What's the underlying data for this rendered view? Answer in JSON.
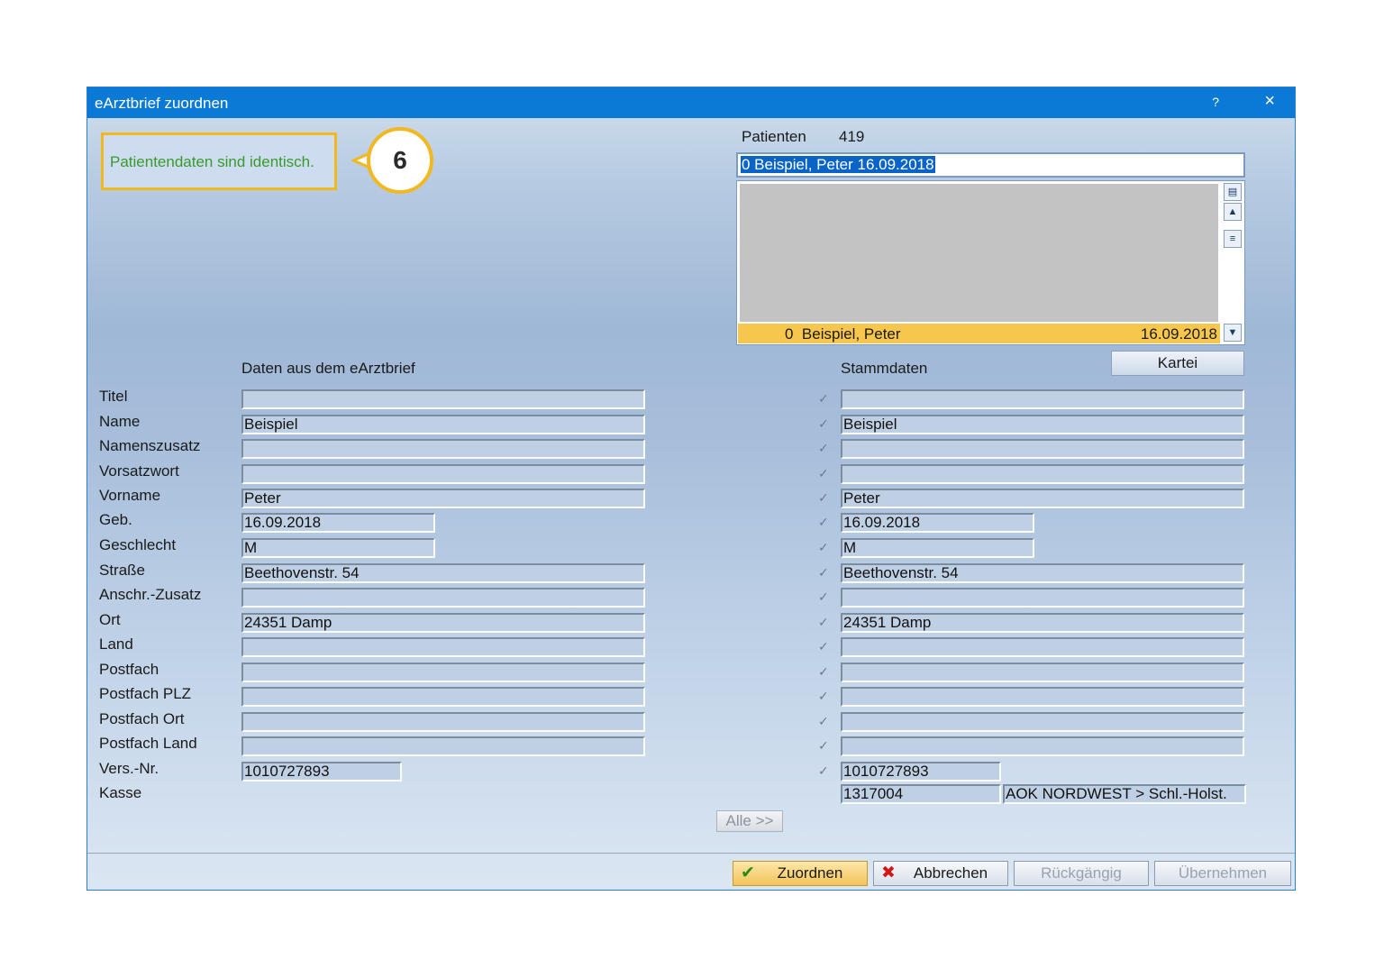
{
  "window": {
    "title": "eArztbrief zuordnen",
    "help": "?",
    "close": "×"
  },
  "notice": {
    "text": "Patientendaten sind identisch.",
    "badge": "6"
  },
  "patients": {
    "label": "Patienten",
    "count": "419",
    "search_value": "0 Beispiel, Peter  16.09.2018",
    "selected": {
      "number": "0",
      "name": "Beispiel, Peter",
      "date": "16.09.2018"
    }
  },
  "headers": {
    "left": "Daten aus dem eArztbrief",
    "right": "Stammdaten",
    "kartei": "Kartei"
  },
  "check_mark": "✓",
  "rows": [
    {
      "label": "Titel",
      "left": "",
      "right": ""
    },
    {
      "label": "Name",
      "left": "Beispiel",
      "right": "Beispiel"
    },
    {
      "label": "Namenszusatz",
      "left": "",
      "right": ""
    },
    {
      "label": "Vorsatzwort",
      "left": "",
      "right": ""
    },
    {
      "label": "Vorname",
      "left": "Peter",
      "right": "Peter"
    },
    {
      "label": "Geb.",
      "left": "16.09.2018",
      "right": "16.09.2018"
    },
    {
      "label": "Geschlecht",
      "left": "M",
      "right": "M"
    },
    {
      "label": "Straße",
      "left": "Beethovenstr. 54",
      "right": "Beethovenstr. 54"
    },
    {
      "label": "Anschr.-Zusatz",
      "left": "",
      "right": ""
    },
    {
      "label": "Ort",
      "left": "24351 Damp",
      "right": "24351 Damp"
    },
    {
      "label": "Land",
      "left": "",
      "right": ""
    },
    {
      "label": "Postfach",
      "left": "",
      "right": ""
    },
    {
      "label": "Postfach PLZ",
      "left": "",
      "right": ""
    },
    {
      "label": "Postfach Ort",
      "left": "",
      "right": ""
    },
    {
      "label": "Postfach Land",
      "left": "",
      "right": ""
    },
    {
      "label": "Vers.-Nr.",
      "left": "1010727893",
      "right": "1010727893"
    }
  ],
  "kasse": {
    "label": "Kasse",
    "number": "1317004",
    "name": "AOK NORDWEST > Schl.-Holst."
  },
  "buttons": {
    "alle": "Alle >>",
    "zuordnen": "Zuordnen",
    "abbrechen": "Abbrechen",
    "rueckgaengig": "Rückgängig",
    "uebernehmen": "Übernehmen"
  }
}
